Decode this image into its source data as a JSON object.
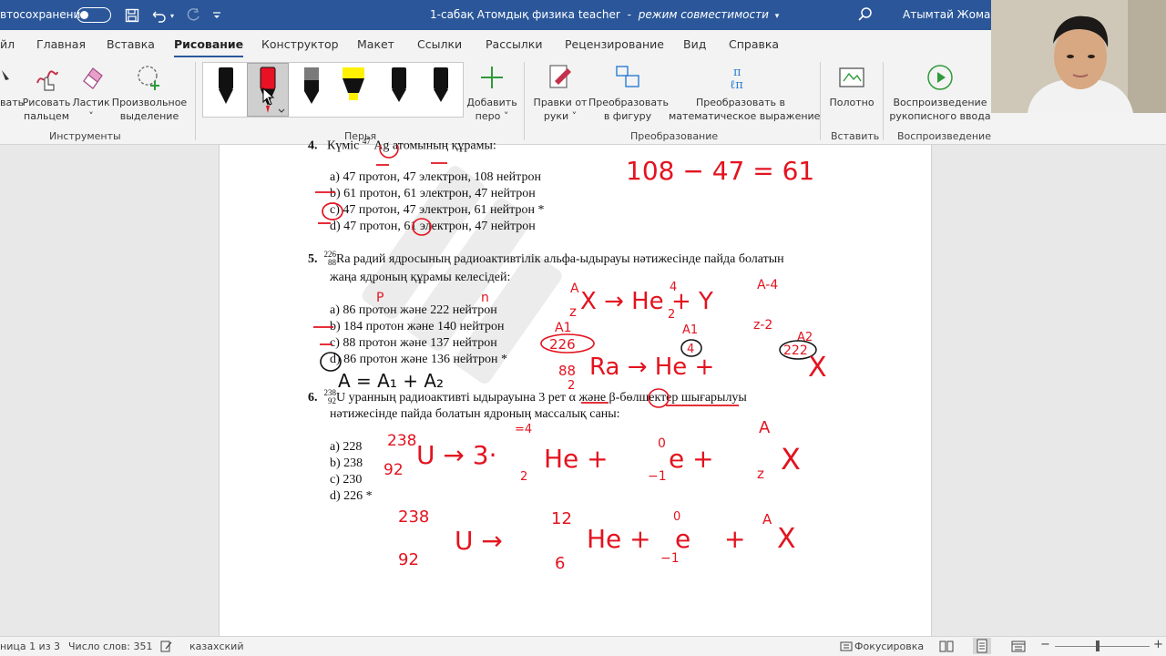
{
  "titlebar": {
    "autosave_label": "втосохранение",
    "doc_title": "1-сабақ Атомдық физика teacher",
    "mode": "режим совместимости",
    "user": "Атымтай Жомарт"
  },
  "tabs": [
    {
      "label": "йл"
    },
    {
      "label": "Главная"
    },
    {
      "label": "Вставка"
    },
    {
      "label": "Рисование"
    },
    {
      "label": "Конструктор"
    },
    {
      "label": "Макет"
    },
    {
      "label": "Ссылки"
    },
    {
      "label": "Рассылки"
    },
    {
      "label": "Рецензирование"
    },
    {
      "label": "Вид"
    },
    {
      "label": "Справка"
    }
  ],
  "ribbon": {
    "draw": "вать",
    "finger_draw": [
      "Рисовать",
      "пальцем"
    ],
    "eraser": [
      "Ластик",
      "˅"
    ],
    "lasso": [
      "Произвольное",
      "выделение"
    ],
    "tools_group": "Инструменты",
    "pens_group": "Перья",
    "add_pen": [
      "Добавить",
      "перо ˅"
    ],
    "edit_by_hand": [
      "Правки от",
      "руки ˅"
    ],
    "to_shape": [
      "Преобразовать",
      "в фигуру"
    ],
    "to_math": [
      "Преобразовать в",
      "математическое выражение"
    ],
    "convert_group": "Преобразование",
    "canvas": [
      "Полотно"
    ],
    "insert_group": "Вставить",
    "replay": [
      "Воспроизведение",
      "рукописного ввода"
    ],
    "replay_group": "Воспроизведение"
  },
  "pen_colors": [
    "#111111",
    "#e81224",
    "#7a7a7a",
    "#fff100",
    "#111111",
    "#111111"
  ],
  "document": {
    "q4": {
      "stem_left": "Күміс",
      "stem_sup": "47",
      "stem_right": "Ag атомының құрамы:",
      "options": [
        "a) 47 протон, 47 электрон, 108 нейтрон",
        "b) 61 протон, 61 электрон, 47 нейтрон",
        "c) 47 протон, 47 электрон, 61 нейтрон *",
        "d) 47 протон, 61 электрон, 47 нейтрон"
      ]
    },
    "q5": {
      "num": "5.",
      "sup": "226",
      "sub": "88",
      "line1": "Ra радий ядросының радиоактивтілік альфа-ыдырауы нәтижесінде пайда болатын",
      "line2": "жаңа ядроның құрамы келесідей:",
      "options": [
        "a) 86 протон және 222 нейтрон",
        "b) 184 протон және 140 нейтрон",
        "c) 88 протон және 137 нейтрон",
        "d) 86 протон және 136 нейтрон *"
      ]
    },
    "q6": {
      "num": "6.",
      "sup": "238",
      "sub": "92",
      "line1": "U уранның радиоактивті ыдырауына 3 рет α және β-бөлшектер шығарылуы",
      "line2": "нәтижесінде пайда болатын ядроның массалық саны:",
      "options": [
        "a) 228",
        "b) 238",
        "c) 230",
        "d) 226 *"
      ]
    }
  },
  "ink": {
    "eq1": "108 − 47 = 61",
    "q5_p": "P",
    "q5_n": "n",
    "q5_eq": "X → He + Y",
    "q5_z": "z",
    "q5_a": "A",
    "q5_four": "4",
    "q5_two": "2",
    "q5_a4": "A-4",
    "q5_z2": "z-2",
    "q5_a1": "A1",
    "q5_a2": "A2",
    "q5_226": "226",
    "q5_4": "4",
    "q5_222": "222",
    "q5_88": "88",
    "q5_2b": "2",
    "q5_ra": "Ra → He +",
    "q5_x": "X",
    "q5_sum": "A = A₁ + A₂",
    "q6_238": "238",
    "q6_92": "92",
    "q6_eq": "U → 3·",
    "q6_he": "He +",
    "q6_e": "e +",
    "q6_x": "X",
    "q6_4": "=4",
    "q6_2": "2",
    "q6_0": "0",
    "q6_m1": "−1",
    "q6_A": "A",
    "q6_z": "z",
    "q6_b238": "238",
    "q6_b92": "92",
    "q6_bu": "U →",
    "q6_12": "12",
    "q6_6": "6",
    "q6_bhe": "He +",
    "q6_be": "e",
    "q6_b0": "0",
    "q6_bm1": "−1",
    "q6_bplus": "+",
    "q6_bA": "A",
    "q6_bx": "X"
  },
  "status": {
    "page": "ница 1 из 3",
    "words": "Число слов: 351",
    "lang": "казахский",
    "focus": "Фокусировка"
  }
}
